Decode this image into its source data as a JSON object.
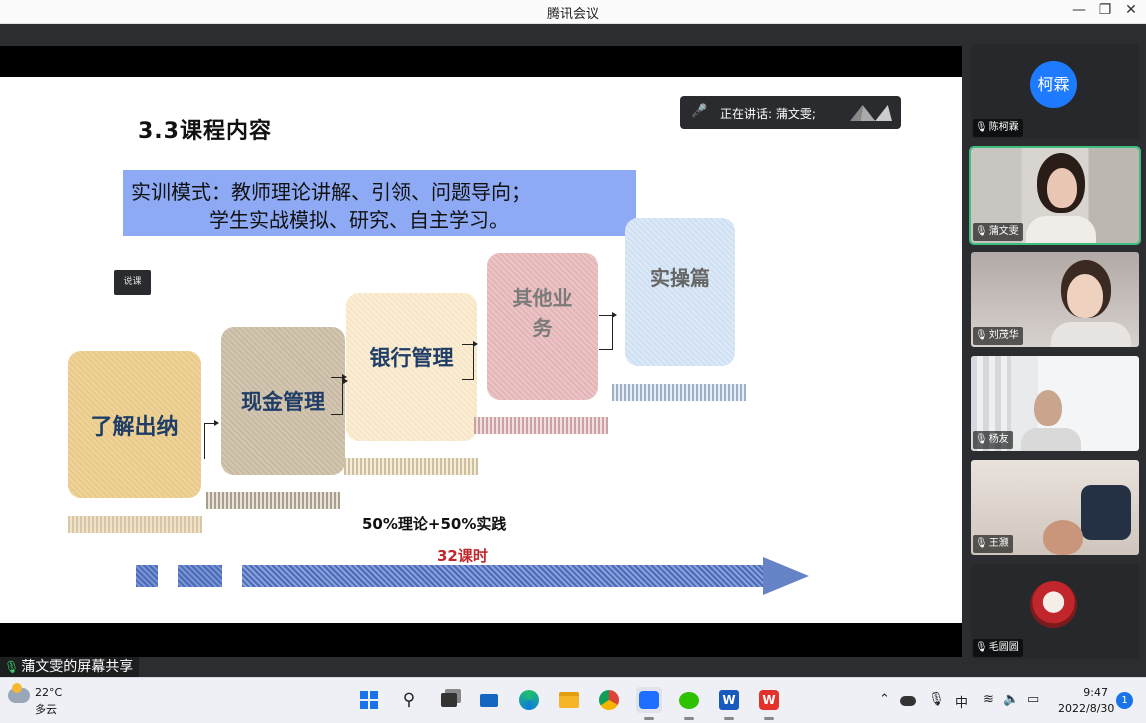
{
  "window": {
    "title": "腾讯会议"
  },
  "slide": {
    "title": "3.3课程内容",
    "mode_line1": "实训模式：教师理论讲解、引领、问题导向；",
    "mode_line2": "学生实战模拟、研究、自主学习。",
    "tooltip": "说课",
    "cards": [
      "了解出纳",
      "现金管理",
      "银行管理",
      "其他业务",
      "实操篇"
    ],
    "ratio": "50%理论+50%实践",
    "hours": "32课时"
  },
  "speaking": {
    "label": "正在讲话: 蒲文雯;"
  },
  "share_label": "蒲文雯的屏幕共享",
  "participants": [
    {
      "name": "陈柯霖",
      "avatar_text": "柯霖"
    },
    {
      "name": "蒲文雯"
    },
    {
      "name": "刘茂华"
    },
    {
      "name": "杨友"
    },
    {
      "name": "王灏"
    },
    {
      "name": "毛圆圆"
    }
  ],
  "taskbar": {
    "temperature": "22°C",
    "condition": "多云",
    "ime": "中",
    "time": "9:47",
    "date": "2022/8/30",
    "notifications": "1"
  }
}
